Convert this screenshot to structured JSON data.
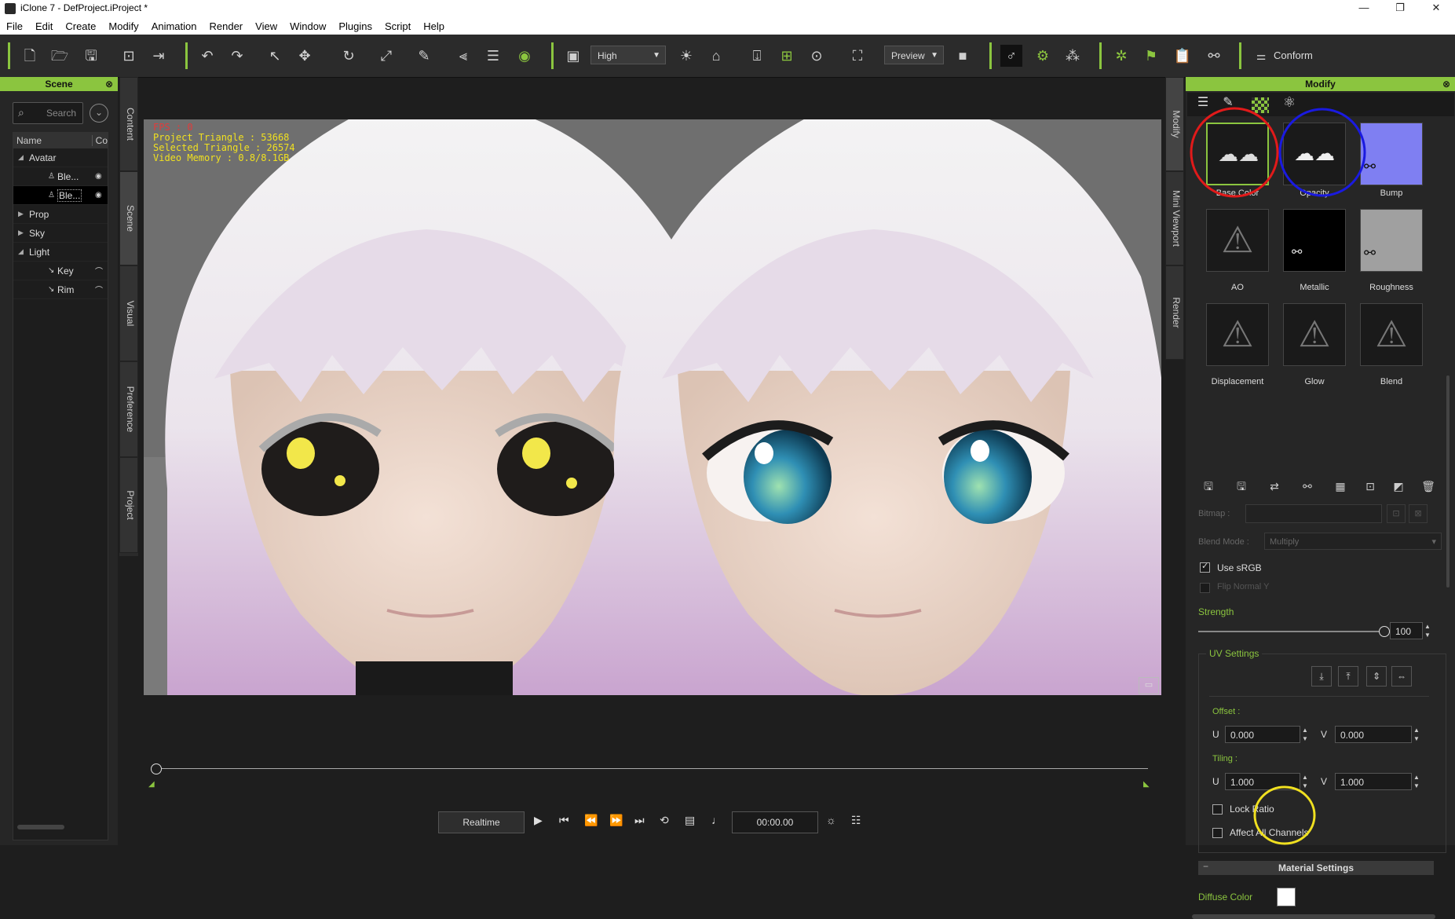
{
  "window": {
    "title": "iClone 7 - DefProject.iProject *"
  },
  "menu": [
    "File",
    "Edit",
    "Create",
    "Modify",
    "Animation",
    "Render",
    "View",
    "Window",
    "Plugins",
    "Script",
    "Help"
  ],
  "toolbar": {
    "quality": "High",
    "render_mode": "Preview",
    "conform": "Conform"
  },
  "scene_panel": {
    "title": "Scene",
    "search_placeholder": "Search",
    "col_name": "Name",
    "col_c": "Co",
    "rows": [
      {
        "label": "Avatar",
        "level": 0,
        "exp": "◢"
      },
      {
        "label": "Ble...",
        "level": 1,
        "exp": ""
      },
      {
        "label": "Ble...",
        "level": 1,
        "exp": ""
      },
      {
        "label": "Prop",
        "level": 0,
        "exp": "▶"
      },
      {
        "label": "Sky",
        "level": 0,
        "exp": "▶"
      },
      {
        "label": "Light",
        "level": 0,
        "exp": "◢"
      },
      {
        "label": "Key",
        "level": 2,
        "exp": ""
      },
      {
        "label": "Rim",
        "level": 2,
        "exp": ""
      }
    ]
  },
  "left_tabs": [
    "Content",
    "Scene",
    "Visual",
    "Preference",
    "Project"
  ],
  "right_tabs": [
    "Modify",
    "Mini Viewport",
    "Render"
  ],
  "viewport": {
    "fps": "FPS : 0",
    "project_triangle": "Project Triangle : 53668",
    "selected_triangle": "Selected Triangle : 26574",
    "video_memory": "Video Memory : 0.8/8.1GB"
  },
  "playback": {
    "mode": "Realtime",
    "time": "00:00.00"
  },
  "modify_panel": {
    "title": "Modify",
    "channels": [
      "Base Color",
      "Opacity",
      "Bump",
      "AO",
      "Metallic",
      "Roughness",
      "Displacement",
      "Glow",
      "Blend"
    ],
    "bitmap_label": "Bitmap :",
    "blend_mode_label": "Blend Mode :",
    "blend_mode_value": "Multiply",
    "use_srgb": "Use sRGB",
    "flip_normal": "Flip Normal Y",
    "strength_label": "Strength",
    "strength_value": "100",
    "strength": 1.0,
    "uv_settings": "UV Settings",
    "offset_label": "Offset :",
    "tiling_label": "Tiling :",
    "u": "U",
    "v": "V",
    "offset_u": "0.000",
    "offset_v": "0.000",
    "tiling_u": "1.000",
    "tiling_v": "1.000",
    "lock_ratio": "Lock Ratio",
    "affect_all": "Affect All Channels",
    "material_settings": "Material Settings",
    "diffuse_color": "Diffuse Color"
  },
  "colors": {
    "accent": "#8bc53f",
    "annot_red": "#e11a1a",
    "annot_blue": "#1a1ae0",
    "annot_yellow": "#f0e020"
  }
}
